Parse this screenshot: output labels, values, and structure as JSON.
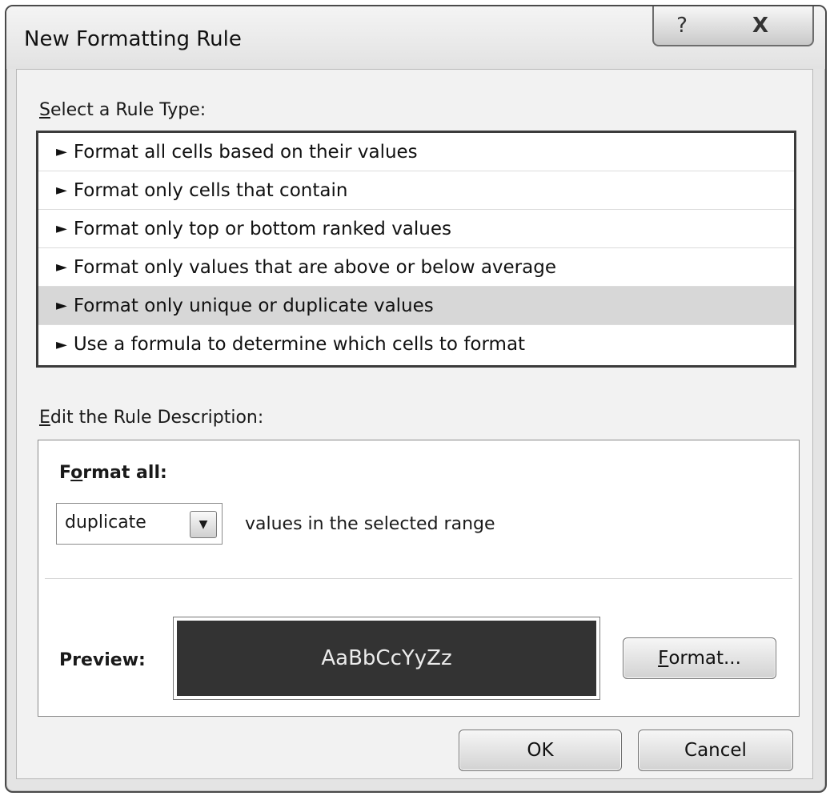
{
  "window": {
    "title": "New Formatting Rule",
    "help_label": "?",
    "close_label": "X"
  },
  "rule_type": {
    "label_accel": "S",
    "label_rest": "elect a Rule Type:",
    "arrow_glyph": "►",
    "items": [
      {
        "label": "Format all cells based on their values",
        "selected": false
      },
      {
        "label": "Format only cells that contain",
        "selected": false
      },
      {
        "label": "Format only top or bottom ranked values",
        "selected": false
      },
      {
        "label": "Format only values that are above or below average",
        "selected": false
      },
      {
        "label": "Format only unique or duplicate values",
        "selected": true
      },
      {
        "label": "Use a formula to determine which cells to format",
        "selected": false
      }
    ]
  },
  "description": {
    "label_accel": "E",
    "label_rest": "dit the Rule Description:",
    "format_all_pre": "F",
    "format_all_accel": "o",
    "format_all_post": "rmat all:",
    "dropdown_value": "duplicate",
    "dropdown_arrow": "▼",
    "values_text": "values in the selected range",
    "preview_label": "Preview:",
    "preview_sample": "AaBbCcYyZz",
    "preview_bg": "#333333",
    "format_button_accel": "F",
    "format_button_rest": "ormat..."
  },
  "buttons": {
    "ok": "OK",
    "cancel": "Cancel"
  }
}
